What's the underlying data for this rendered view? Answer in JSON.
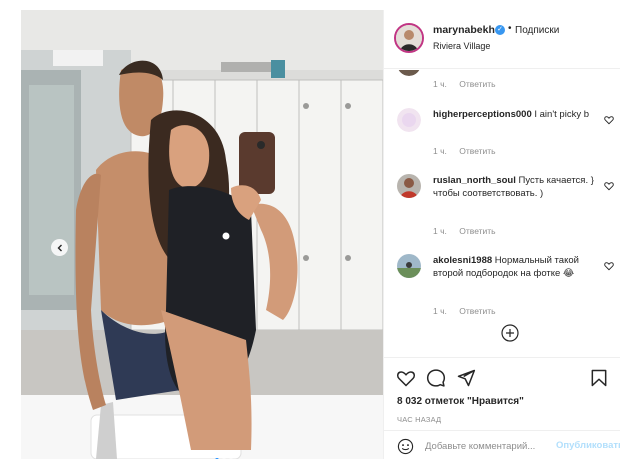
{
  "post": {
    "username": "marynabekh",
    "follow_separator": "•",
    "follow_label": "Подписки",
    "location": "Riviera Village"
  },
  "comments": [
    {
      "username": "",
      "text": "",
      "time": "1 ч.",
      "reply": "Ответить"
    },
    {
      "username": "higherperceptions000",
      "text": "I ain't picky b",
      "time": "1 ч.",
      "reply": "Ответить"
    },
    {
      "username": "ruslan_north_soul",
      "text": "Пусть качается. } чтобы соответствовать. )",
      "time": "1 ч.",
      "reply": "Ответить"
    },
    {
      "username": "akolesni1988",
      "text": "Нормальный такой второй подбородок на фотке 😂",
      "time": "1 ч.",
      "reply": "Ответить"
    }
  ],
  "likes_label": "8 032 отметок \"Нравится\"",
  "time_ago": "ЧАС НАЗАД",
  "comment_box": {
    "placeholder": "Добавьте комментарий...",
    "publish_label": "Опубликовать"
  },
  "colors": {
    "verified": "#3897f0",
    "publish_disabled": "#b2dffc",
    "carousel_active_dot": "#1a8cff"
  },
  "icons": [
    "chevron-left-icon",
    "verified-icon",
    "heart-icon",
    "comment-icon",
    "share-icon",
    "bookmark-icon",
    "emoji-icon",
    "plus-circle-icon"
  ],
  "carousel": {
    "slides": 3,
    "active": 1
  }
}
